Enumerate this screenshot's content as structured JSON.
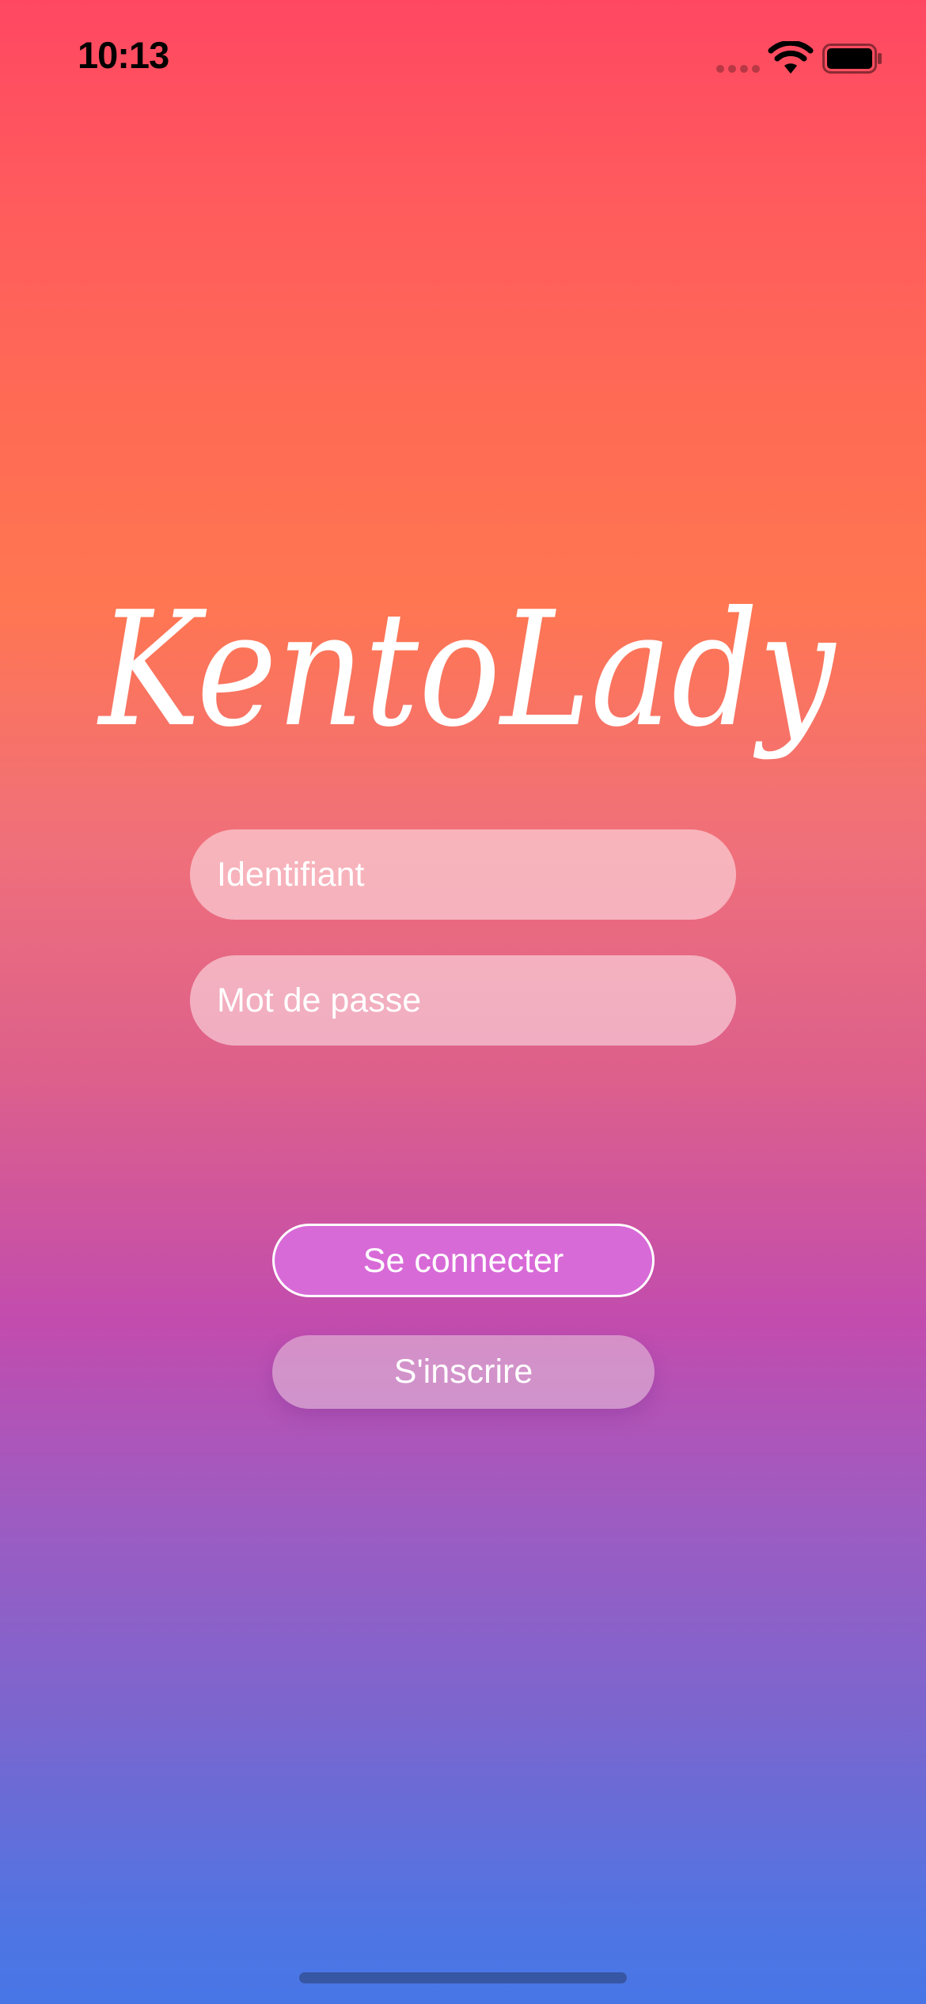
{
  "status_bar": {
    "time": "10:13"
  },
  "logo": {
    "text": "KentoLady"
  },
  "form": {
    "username_placeholder": "Identifiant",
    "password_placeholder": "Mot de passe"
  },
  "actions": {
    "login_label": "Se connecter",
    "signup_label": "S'inscrire"
  },
  "colors": {
    "gradient_top": "#ff4762",
    "gradient_middle": "#c24cae",
    "gradient_bottom": "#4876e6",
    "login_button": "#d86ad8"
  },
  "icons": {
    "signal": "cellular-signal-icon",
    "wifi": "wifi-icon",
    "battery": "battery-icon"
  }
}
